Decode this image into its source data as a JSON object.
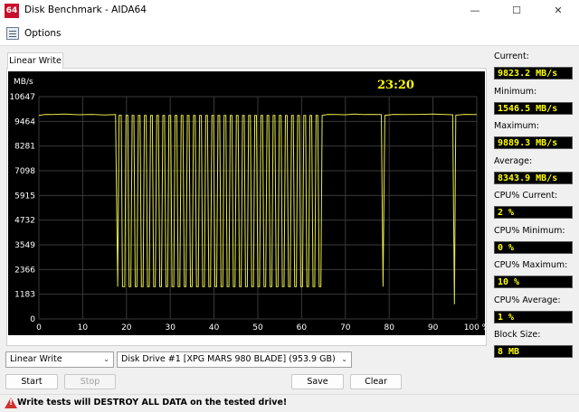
{
  "window": {
    "title": "Disk Benchmark - AIDA64",
    "icon_text": "64",
    "controls": {
      "minimize": "—",
      "maximize": "☐",
      "close": "✕"
    }
  },
  "menu": {
    "options_label": "Options"
  },
  "tab": {
    "label": "Linear Write"
  },
  "graph": {
    "time": "23:20",
    "colors": {
      "background": "#000000",
      "grid": "#3a3a3a",
      "line": "#e8e84a",
      "text": "#ffffff",
      "time": "#ffff00"
    }
  },
  "chart_data": {
    "type": "line",
    "title": "",
    "xlabel": "",
    "ylabel": "MB/s",
    "x_tick_labels": [
      "0",
      "10",
      "20",
      "30",
      "40",
      "50",
      "60",
      "70",
      "80",
      "90",
      "100 %"
    ],
    "y_tick_labels": [
      "0",
      "1183",
      "2366",
      "3549",
      "4732",
      "5915",
      "7098",
      "8281",
      "9464",
      "10647"
    ],
    "xlim": [
      0,
      100
    ],
    "ylim": [
      0,
      10647
    ],
    "grid": true,
    "series": [
      {
        "values": [
          [
            0,
            9750
          ],
          [
            1.5,
            9800
          ],
          [
            3,
            9790
          ],
          [
            6,
            9810
          ],
          [
            9,
            9780
          ],
          [
            12,
            9800
          ],
          [
            15,
            9770
          ],
          [
            17.5,
            9790
          ],
          [
            18,
            1550
          ],
          [
            18.3,
            9750
          ],
          [
            18.8,
            9760
          ],
          [
            19.1,
            1550
          ],
          [
            19.6,
            1550
          ],
          [
            19.9,
            9750
          ],
          [
            20.3,
            9760
          ],
          [
            20.6,
            1550
          ],
          [
            21.0,
            1550
          ],
          [
            21.3,
            9750
          ],
          [
            21.7,
            9750
          ],
          [
            22.0,
            1550
          ],
          [
            22.4,
            1550
          ],
          [
            22.7,
            9750
          ],
          [
            23.1,
            9750
          ],
          [
            23.4,
            1550
          ],
          [
            23.8,
            1550
          ],
          [
            24.1,
            9750
          ],
          [
            24.5,
            9750
          ],
          [
            24.8,
            1550
          ],
          [
            25.2,
            1550
          ],
          [
            25.5,
            9750
          ],
          [
            25.9,
            9750
          ],
          [
            26.2,
            1550
          ],
          [
            26.6,
            1550
          ],
          [
            26.9,
            9750
          ],
          [
            27.3,
            9750
          ],
          [
            27.6,
            1550
          ],
          [
            28.0,
            1550
          ],
          [
            28.3,
            9750
          ],
          [
            28.7,
            9750
          ],
          [
            29.0,
            1550
          ],
          [
            29.4,
            1550
          ],
          [
            29.7,
            9750
          ],
          [
            30.1,
            9750
          ],
          [
            30.4,
            1550
          ],
          [
            30.8,
            1550
          ],
          [
            31.1,
            9750
          ],
          [
            31.5,
            9750
          ],
          [
            31.8,
            1550
          ],
          [
            32.2,
            1550
          ],
          [
            32.5,
            9750
          ],
          [
            32.9,
            9750
          ],
          [
            33.2,
            1550
          ],
          [
            33.6,
            1550
          ],
          [
            33.9,
            9750
          ],
          [
            34.3,
            9750
          ],
          [
            34.6,
            1550
          ],
          [
            35.0,
            1550
          ],
          [
            35.3,
            9750
          ],
          [
            35.7,
            9750
          ],
          [
            36.0,
            1550
          ],
          [
            36.4,
            1550
          ],
          [
            36.7,
            9750
          ],
          [
            37.1,
            9750
          ],
          [
            37.4,
            1550
          ],
          [
            37.8,
            1550
          ],
          [
            38.1,
            9750
          ],
          [
            38.5,
            9750
          ],
          [
            38.8,
            1550
          ],
          [
            39.2,
            1550
          ],
          [
            39.5,
            9750
          ],
          [
            39.9,
            9750
          ],
          [
            40.2,
            1550
          ],
          [
            40.6,
            1550
          ],
          [
            40.9,
            9750
          ],
          [
            41.3,
            9750
          ],
          [
            41.6,
            1550
          ],
          [
            42.0,
            1550
          ],
          [
            42.3,
            9750
          ],
          [
            42.7,
            9750
          ],
          [
            43.0,
            1550
          ],
          [
            43.4,
            1550
          ],
          [
            43.7,
            9750
          ],
          [
            44.1,
            9750
          ],
          [
            44.4,
            1550
          ],
          [
            44.8,
            1550
          ],
          [
            45.1,
            9750
          ],
          [
            45.5,
            9750
          ],
          [
            45.8,
            1550
          ],
          [
            46.2,
            1550
          ],
          [
            46.5,
            9750
          ],
          [
            46.9,
            9750
          ],
          [
            47.2,
            1550
          ],
          [
            47.6,
            1550
          ],
          [
            47.9,
            9750
          ],
          [
            48.3,
            9750
          ],
          [
            48.6,
            1550
          ],
          [
            49.0,
            1550
          ],
          [
            49.3,
            9750
          ],
          [
            49.7,
            9750
          ],
          [
            50.0,
            1550
          ],
          [
            50.4,
            1550
          ],
          [
            50.7,
            9750
          ],
          [
            51.1,
            9750
          ],
          [
            51.4,
            1550
          ],
          [
            51.8,
            1550
          ],
          [
            52.1,
            9750
          ],
          [
            52.5,
            9750
          ],
          [
            52.8,
            1550
          ],
          [
            53.2,
            1550
          ],
          [
            53.5,
            9750
          ],
          [
            53.9,
            9750
          ],
          [
            54.2,
            1550
          ],
          [
            54.6,
            1550
          ],
          [
            54.9,
            9750
          ],
          [
            55.3,
            9750
          ],
          [
            55.6,
            1550
          ],
          [
            56.0,
            1550
          ],
          [
            56.3,
            9750
          ],
          [
            56.7,
            9750
          ],
          [
            57.0,
            1550
          ],
          [
            57.4,
            1550
          ],
          [
            57.7,
            9750
          ],
          [
            58.1,
            9750
          ],
          [
            58.4,
            1550
          ],
          [
            58.8,
            1550
          ],
          [
            59.1,
            9750
          ],
          [
            59.5,
            9750
          ],
          [
            59.8,
            1550
          ],
          [
            60.2,
            1550
          ],
          [
            60.5,
            9750
          ],
          [
            60.9,
            9750
          ],
          [
            61.2,
            1550
          ],
          [
            61.6,
            1550
          ],
          [
            61.9,
            9750
          ],
          [
            62.3,
            9750
          ],
          [
            62.6,
            1550
          ],
          [
            63.0,
            1550
          ],
          [
            63.3,
            9750
          ],
          [
            63.7,
            9750
          ],
          [
            64.0,
            1550
          ],
          [
            64.4,
            1550
          ],
          [
            64.7,
            9750
          ],
          [
            66,
            9800
          ],
          [
            68,
            9790
          ],
          [
            70,
            9780
          ],
          [
            72,
            9810
          ],
          [
            74,
            9790
          ],
          [
            76,
            9800
          ],
          [
            78.2,
            9790
          ],
          [
            78.6,
            1550
          ],
          [
            79.0,
            9750
          ],
          [
            81,
            9800
          ],
          [
            84,
            9790
          ],
          [
            87,
            9800
          ],
          [
            90,
            9810
          ],
          [
            93,
            9790
          ],
          [
            94.5,
            9780
          ],
          [
            94.9,
            700
          ],
          [
            95.2,
            9760
          ],
          [
            97,
            9800
          ],
          [
            100,
            9790
          ]
        ]
      }
    ]
  },
  "stats": [
    {
      "label": "Current:",
      "value": "9823.2 MB/s"
    },
    {
      "label": "Minimum:",
      "value": "1546.5 MB/s"
    },
    {
      "label": "Maximum:",
      "value": "9889.3 MB/s"
    },
    {
      "label": "Average:",
      "value": "8343.9 MB/s"
    },
    {
      "label": "CPU% Current:",
      "value": "2 %"
    },
    {
      "label": "CPU% Minimum:",
      "value": "0 %"
    },
    {
      "label": "CPU% Maximum:",
      "value": "10 %"
    },
    {
      "label": "CPU% Average:",
      "value": "1 %"
    },
    {
      "label": "Block Size:",
      "value": "8 MB"
    }
  ],
  "controls": {
    "test_select": {
      "value": "Linear Write"
    },
    "drive_select": {
      "value": "Disk Drive #1  [XPG MARS 980 BLADE]  (953.9 GB)"
    },
    "start_label": "Start",
    "stop_label": "Stop",
    "save_label": "Save",
    "clear_label": "Clear"
  },
  "status": {
    "warning_text": "Write tests will DESTROY ALL DATA on the tested drive!"
  }
}
